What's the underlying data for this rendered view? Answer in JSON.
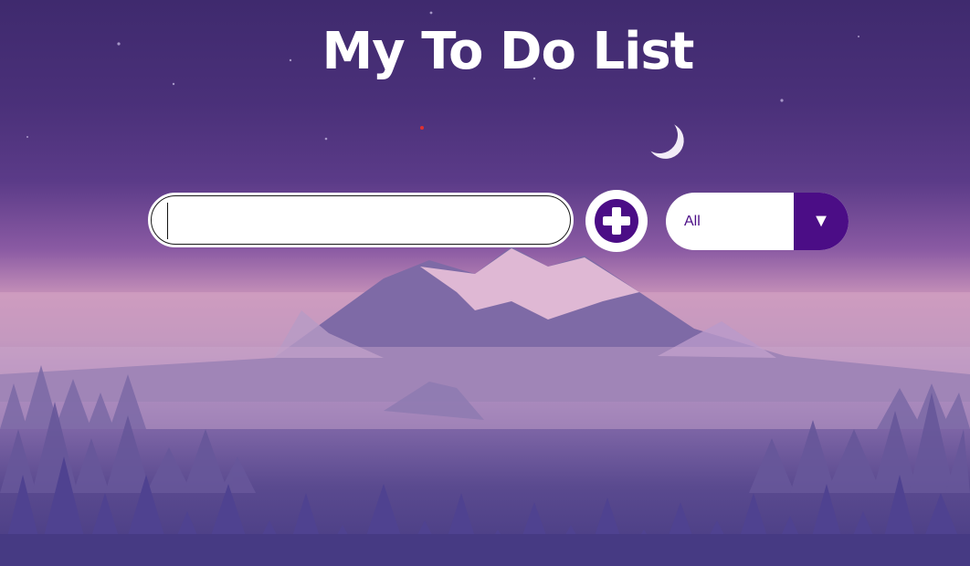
{
  "app": {
    "title": "My To Do List"
  },
  "todo_input": {
    "value": "",
    "placeholder": ""
  },
  "add_button": {
    "icon": "plus-circle-icon"
  },
  "filter": {
    "selected": "All",
    "arrow_glyph": "▼"
  },
  "colors": {
    "accent": "#4b0d86",
    "title_text": "#ffffff",
    "field_bg": "#ffffff"
  }
}
